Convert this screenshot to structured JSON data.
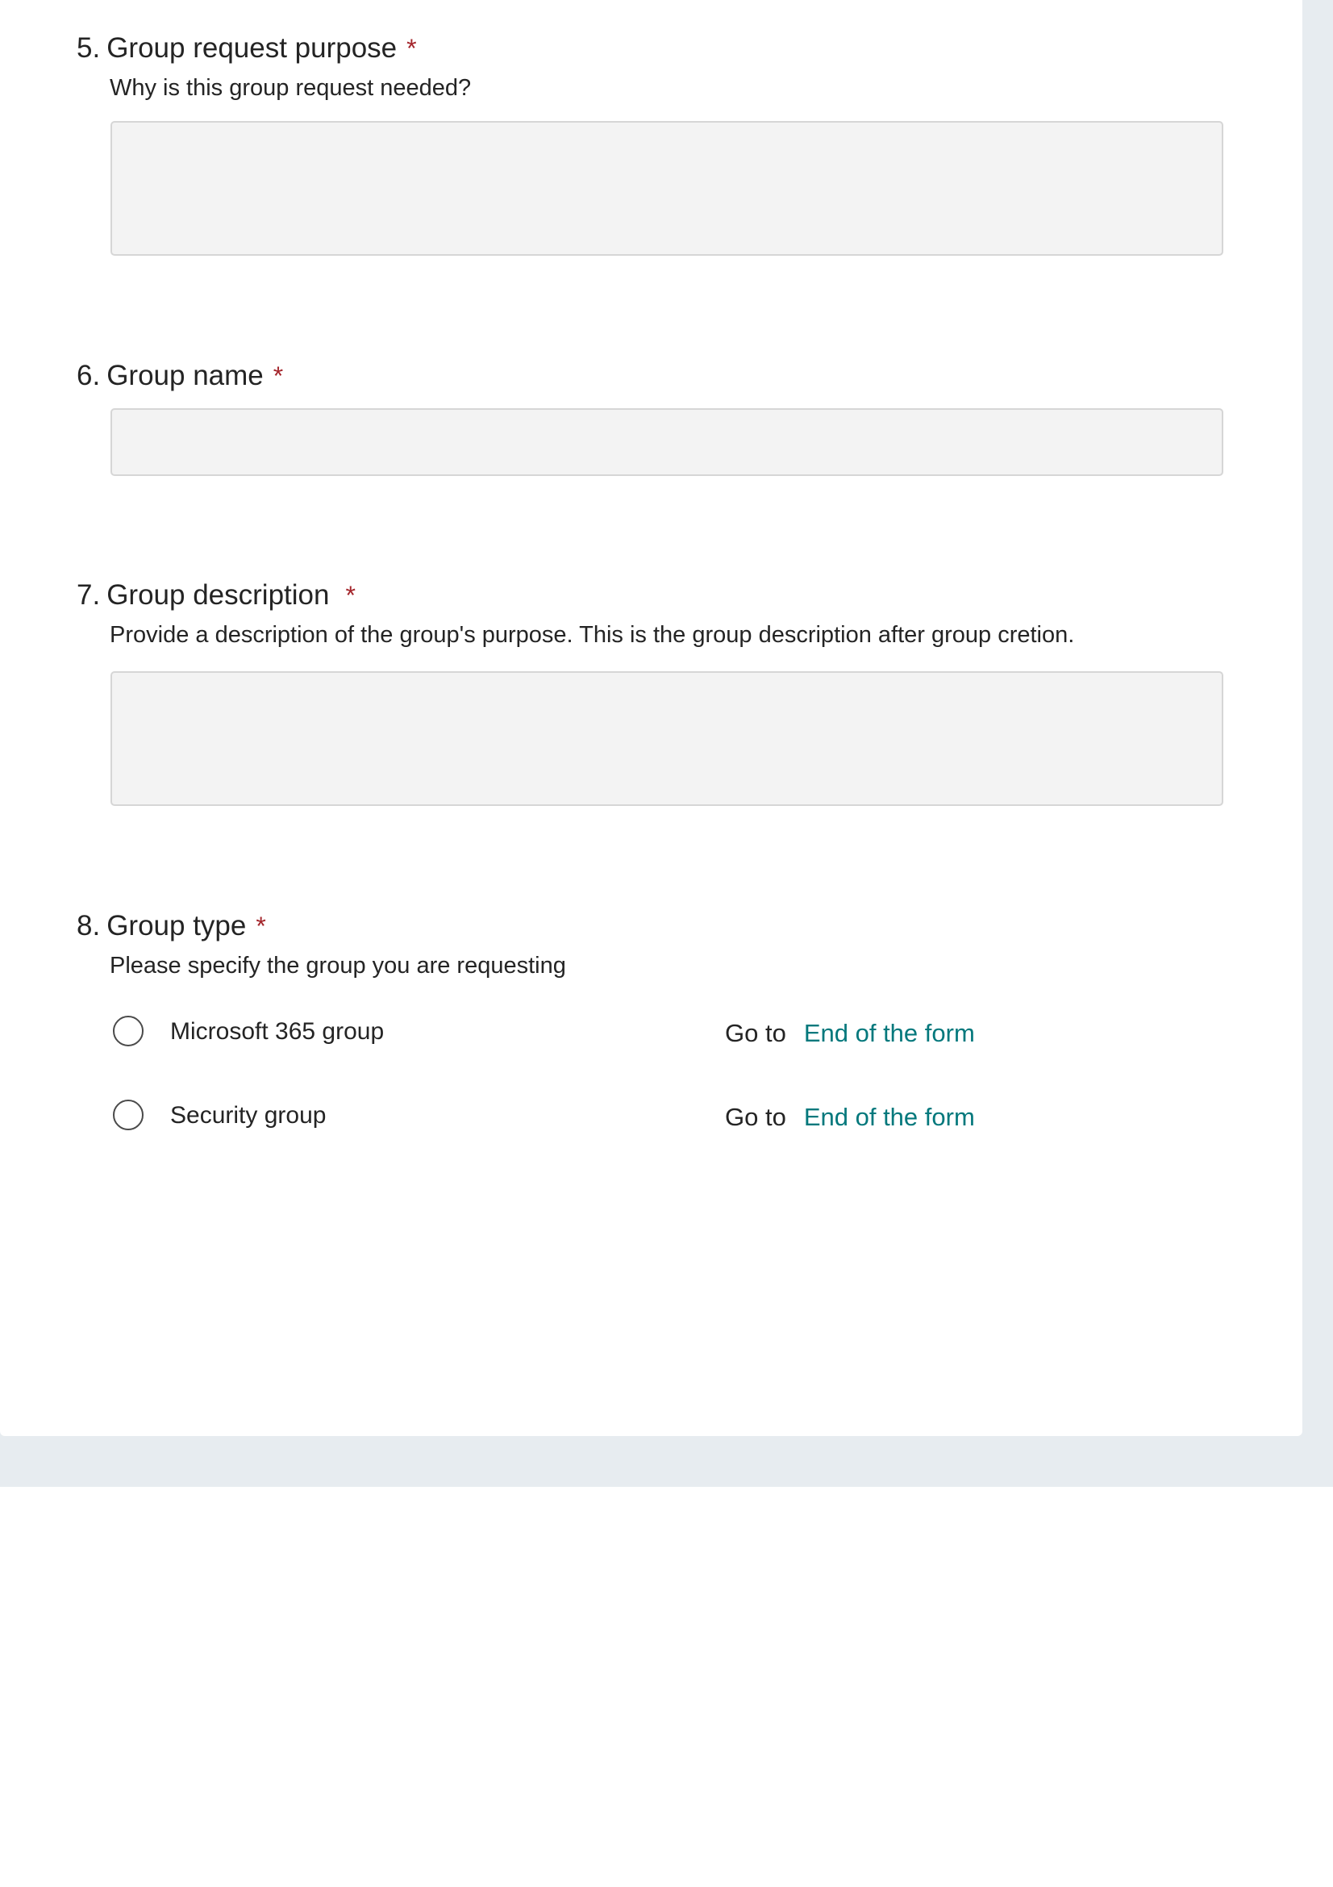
{
  "questions": [
    {
      "number": "5.",
      "title": "Group request purpose",
      "required_mark": "*",
      "subtitle": "Why is this group request needed?",
      "answer": ""
    },
    {
      "number": "6.",
      "title": "Group name",
      "required_mark": "*",
      "answer": ""
    },
    {
      "number": "7.",
      "title": "Group description",
      "required_mark": "*",
      "subtitle": "Provide a description of the group's purpose. This is the group description after group cretion.",
      "answer": ""
    },
    {
      "number": "8.",
      "title": "Group type",
      "required_mark": "*",
      "subtitle": "Please specify the group you are requesting",
      "options": [
        {
          "label": "Microsoft 365 group",
          "goto_label": "Go to",
          "goto_target": "End of the form"
        },
        {
          "label": "Security group",
          "goto_label": "Go to",
          "goto_target": "End of the form"
        }
      ]
    }
  ],
  "colors": {
    "required_star": "#a4262c",
    "goto_link": "#03787c",
    "input_background": "#f3f3f3",
    "page_backdrop": "#e7ecf0"
  }
}
